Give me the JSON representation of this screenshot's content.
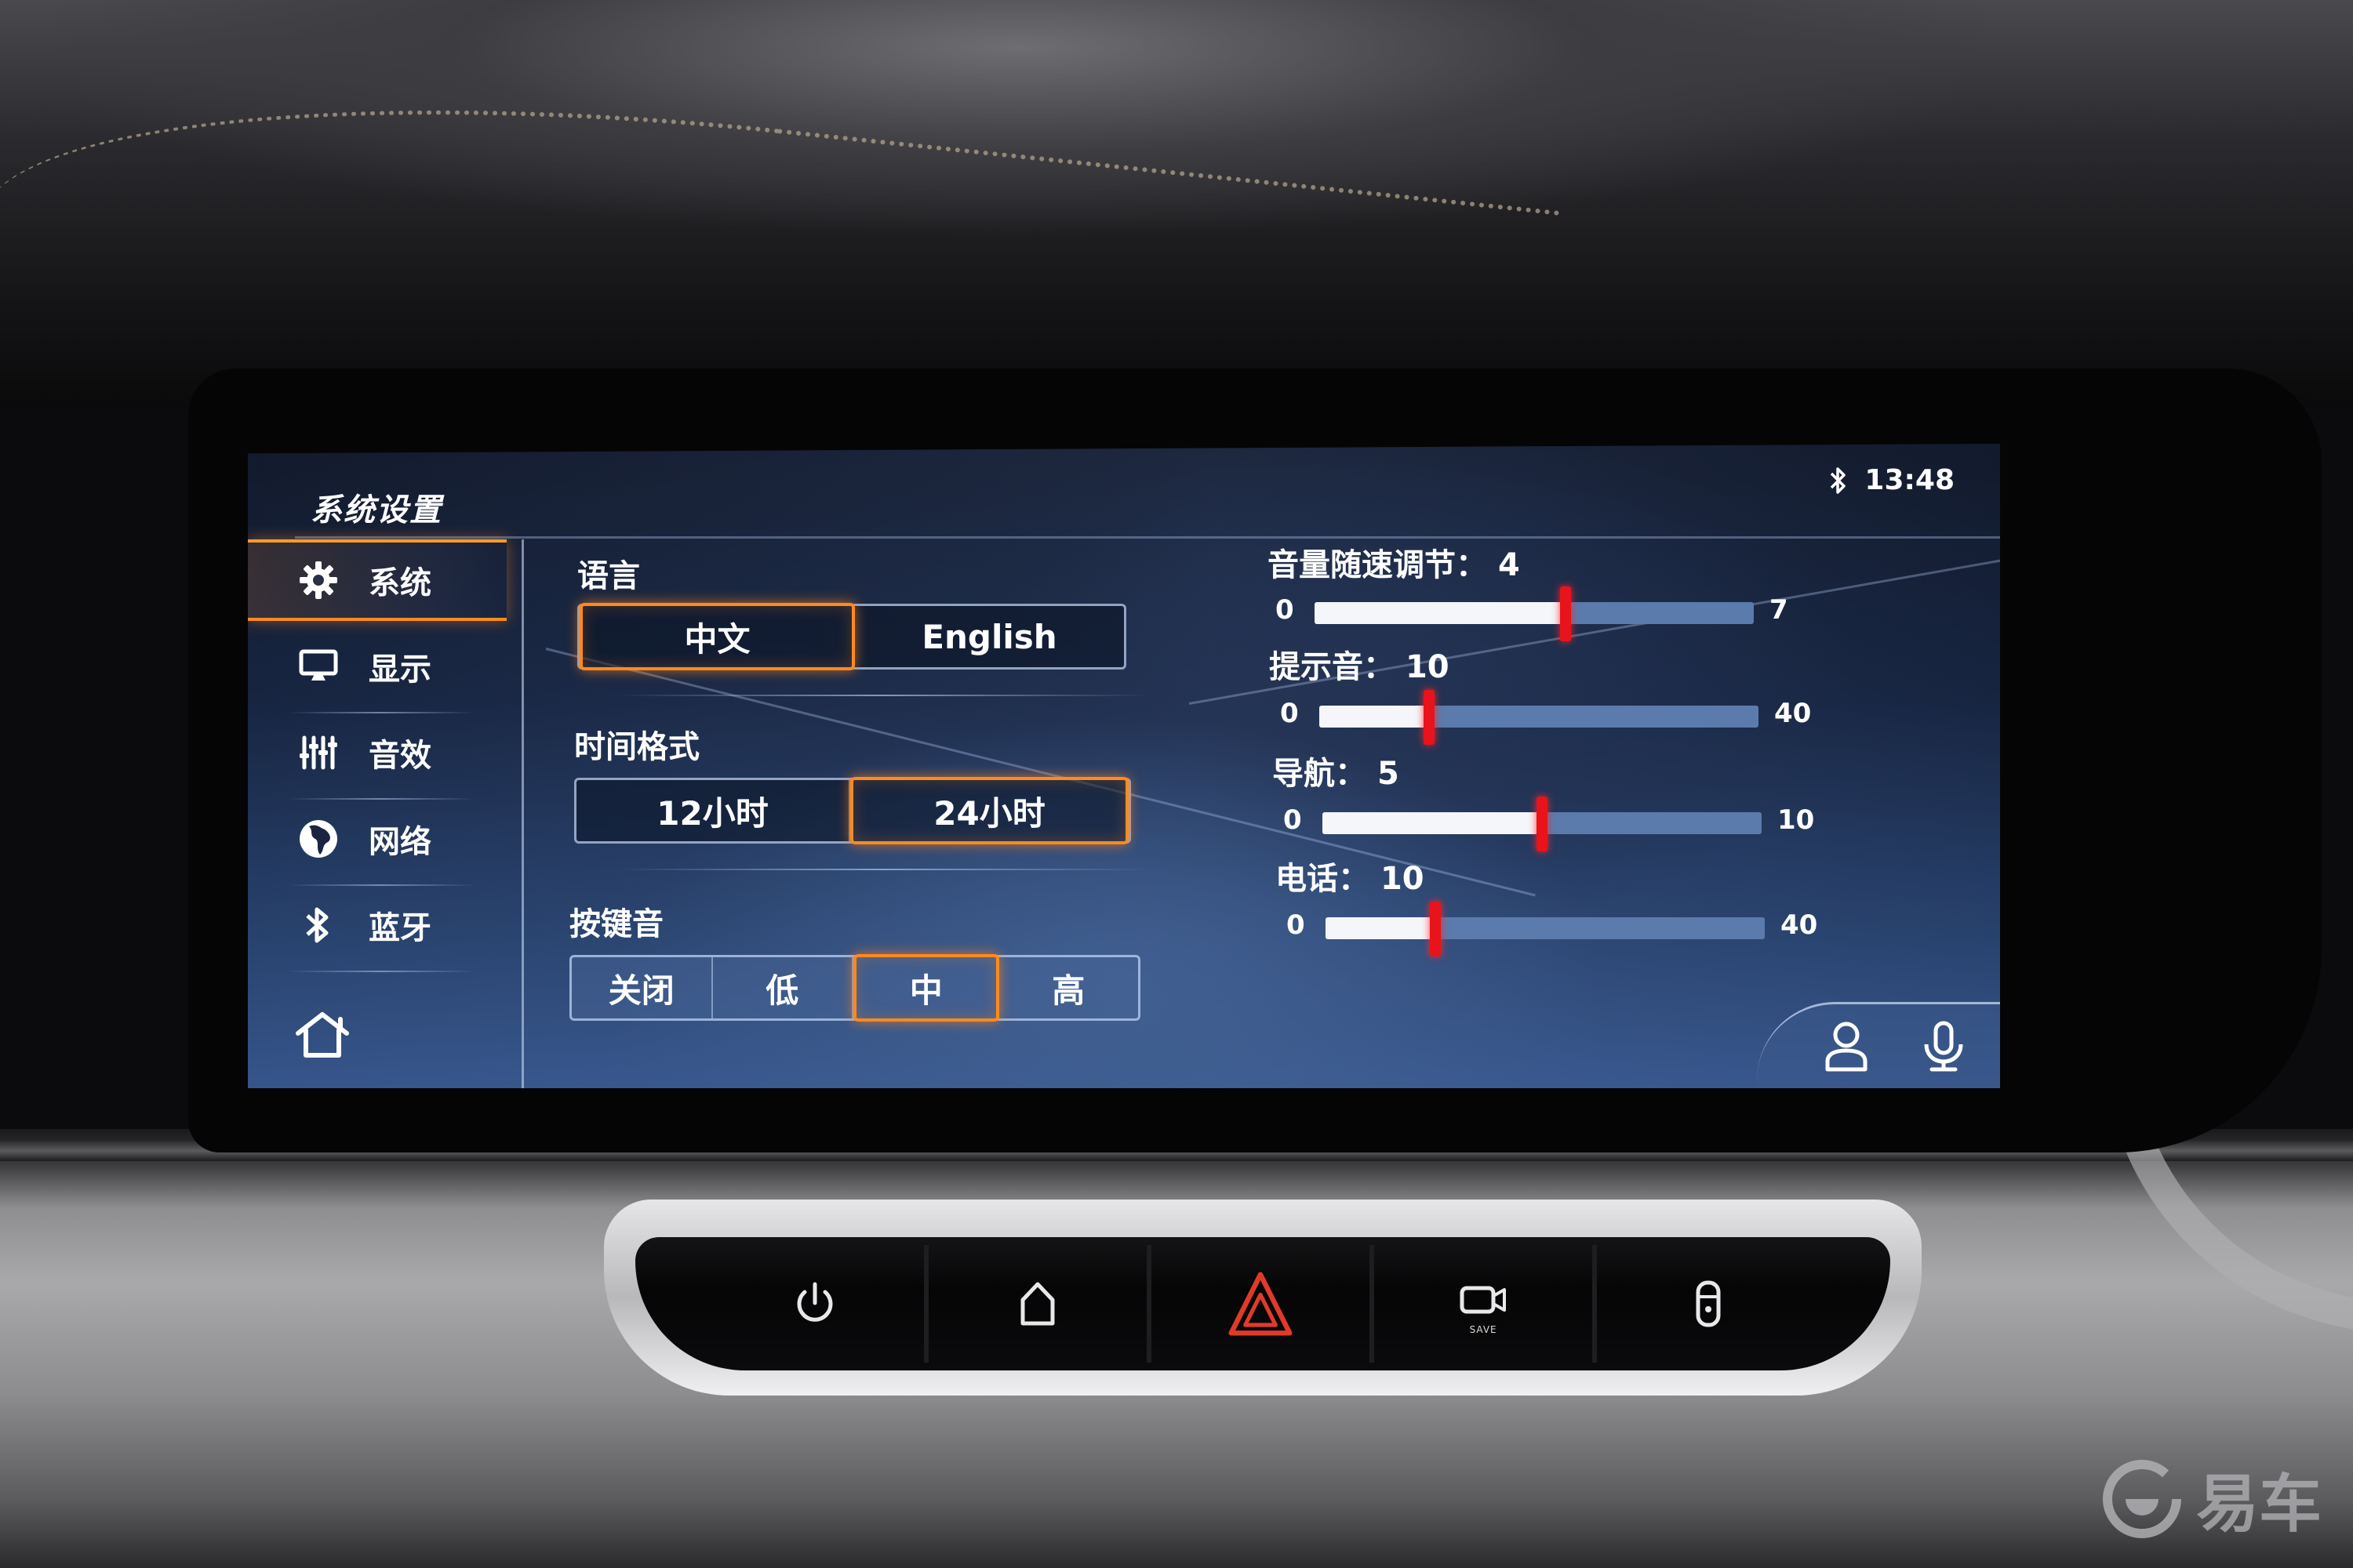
{
  "screen": {
    "title": "系统设置",
    "status": {
      "bluetooth_icon": "bluetooth-icon",
      "time": "13:48"
    }
  },
  "sidebar": {
    "items": [
      {
        "label": "系统",
        "icon": "gear-icon",
        "active": true
      },
      {
        "label": "显示",
        "icon": "monitor-icon",
        "active": false
      },
      {
        "label": "音效",
        "icon": "equalizer-icon",
        "active": false
      },
      {
        "label": "网络",
        "icon": "globe-icon",
        "active": false
      },
      {
        "label": "蓝牙",
        "icon": "bluetooth-icon",
        "active": false
      }
    ],
    "home_icon": "home-icon"
  },
  "settings": {
    "language": {
      "label": "语言",
      "options": [
        "中文",
        "English"
      ],
      "selected": "中文"
    },
    "time_format": {
      "label": "时间格式",
      "options": [
        "12小时",
        "24小时"
      ],
      "selected": "24小时"
    },
    "key_tone": {
      "label": "按键音",
      "options": [
        "关闭",
        "低",
        "中",
        "高"
      ],
      "selected": "中"
    }
  },
  "sliders": [
    {
      "label": "音量随速调节：",
      "value": 4,
      "value_text": "4",
      "min": 0,
      "max": 7,
      "min_text": "0",
      "max_text": "7"
    },
    {
      "label": "提示音：",
      "value": 10,
      "value_text": "10",
      "min": 0,
      "max": 40,
      "min_text": "0",
      "max_text": "40"
    },
    {
      "label": "导航：",
      "value": 5,
      "value_text": "5",
      "min": 0,
      "max": 10,
      "min_text": "0",
      "max_text": "10"
    },
    {
      "label": "电话：",
      "value": 10,
      "value_text": "10",
      "min": 0,
      "max": 40,
      "min_text": "0",
      "max_text": "40"
    }
  ],
  "bottom_actions": [
    {
      "icon": "user-profile-icon"
    },
    {
      "icon": "microphone-icon"
    }
  ],
  "hardware_buttons": [
    {
      "icon": "power-icon"
    },
    {
      "icon": "home-icon"
    },
    {
      "icon": "hazard-warning-icon"
    },
    {
      "icon": "dashcam-save-icon",
      "caption": "SAVE"
    },
    {
      "icon": "car-lock-icon"
    }
  ],
  "colors": {
    "accent_selected": "#ff8a1e",
    "slider_thumb": "#e8131b",
    "slider_fill": "#f4f6fa",
    "slider_track": "#5a7bac",
    "hazard": "#e03a2a"
  },
  "watermark": {
    "text": "易车"
  }
}
